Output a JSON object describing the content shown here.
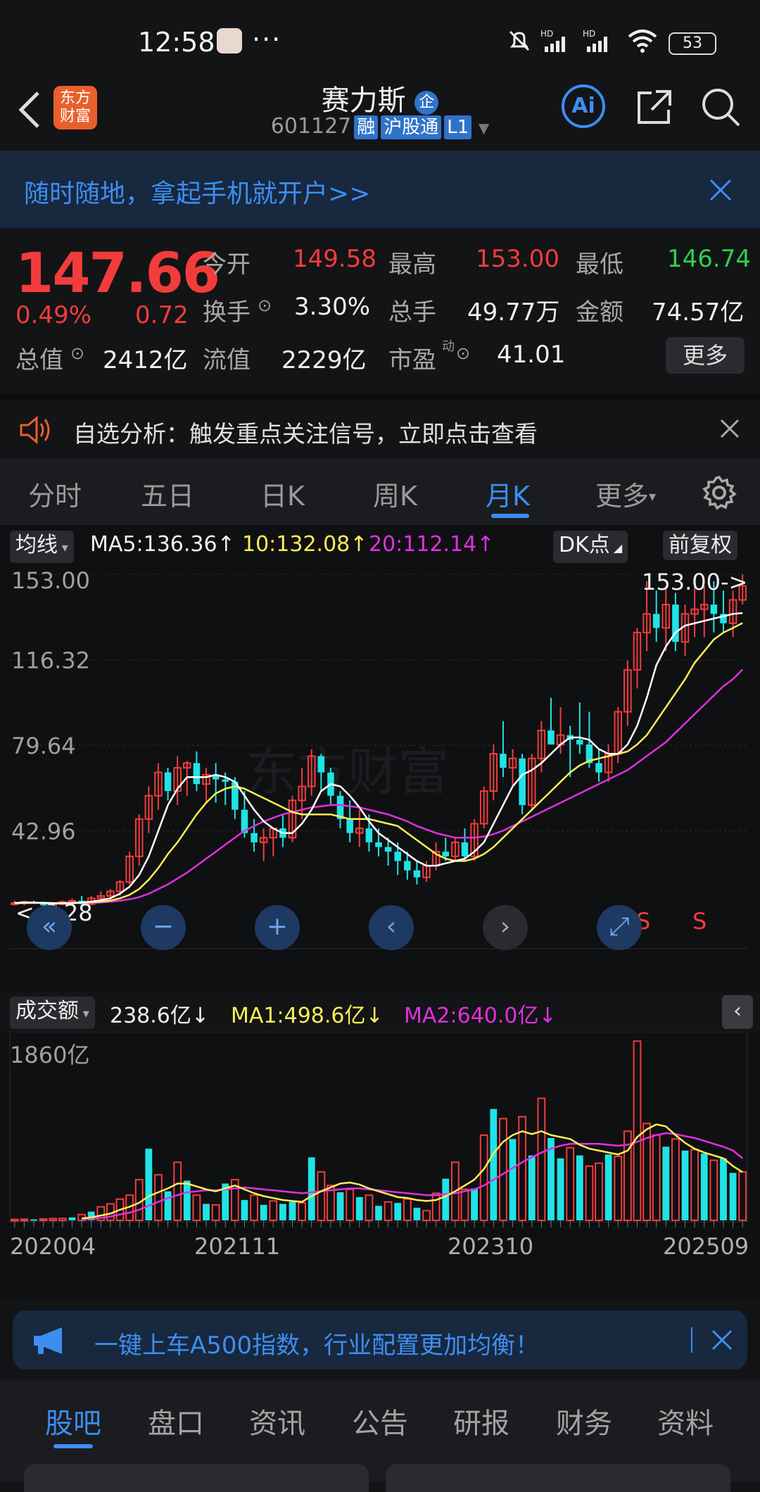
{
  "status_bar": {
    "time": "12:58",
    "more": "···",
    "battery": "53"
  },
  "header": {
    "logo_text": "东方\n财富",
    "stock_name": "赛力斯",
    "stock_badge": "企",
    "stock_code": "601127",
    "tags": [
      "融",
      "沪股通",
      "L1"
    ],
    "ai_label": "Ai"
  },
  "banner": {
    "text": "随时随地，拿起手机就开户>>"
  },
  "quote": {
    "price": "147.66",
    "change_pct": "0.49%",
    "change": "0.72",
    "open_label": "今开",
    "open": "149.58",
    "high_label": "最高",
    "high": "153.00",
    "low_label": "最低",
    "low": "146.74",
    "turnover_label": "换手",
    "turnover": "3.30%",
    "volume_label": "总手",
    "volume": "49.77万",
    "amount_label": "金额",
    "amount": "74.57亿",
    "mktcap_label": "总值",
    "mktcap": "2412亿",
    "float_label": "流值",
    "float": "2229亿",
    "pe_label": "市盈",
    "pe_sup": "动",
    "pe": "41.01",
    "more_button": "更多"
  },
  "alert": {
    "text": "自选分析：触发重点关注信号，立即点击查看"
  },
  "tabs": [
    "分时",
    "五日",
    "日K",
    "周K",
    "月K",
    "更多"
  ],
  "active_tab": "月K",
  "chart_toolbar": {
    "ma_selector": "均线",
    "ma5": "MA5:136.36↑",
    "ma10": "10:132.08↑",
    "ma20": "20:112.14↑",
    "dk_button": "DK点",
    "adjust_button": "前复权"
  },
  "vol_toolbar": {
    "selector": "成交额",
    "current": "238.6亿↓",
    "ma1": "MA1:498.6亿↓",
    "ma2": "MA2:640.0亿↓"
  },
  "colors": {
    "up": "#f23c3c",
    "down": "#1fe3e6",
    "ma5": "#ffffff",
    "ma10": "#ffee55",
    "ma20": "#e030e0",
    "accent": "#3b8ef2"
  },
  "chart_data": [
    {
      "type": "candlestick",
      "y_tick_labels": [
        "153.00",
        "116.32",
        "79.64",
        "42.96"
      ],
      "ylim": [
        6.28,
        153.0
      ],
      "annotations": {
        "max_label": "153.00->",
        "min_label": "<-6.28",
        "signals": [
          "S",
          "S"
        ]
      },
      "x_tick_labels": [
        "202004",
        "202111",
        "202310",
        "202509"
      ],
      "ohlc": [
        [
          12,
          13,
          11,
          12
        ],
        [
          12,
          13,
          11,
          12.5
        ],
        [
          12.5,
          13,
          11.5,
          12
        ],
        [
          12,
          12.5,
          10.5,
          11
        ],
        [
          11,
          12,
          10,
          11.5
        ],
        [
          11.5,
          13,
          11,
          12.5
        ],
        [
          12.5,
          14,
          12,
          13
        ],
        [
          13,
          15,
          11,
          11.5
        ],
        [
          11.5,
          15,
          11,
          14
        ],
        [
          14,
          17,
          12,
          15
        ],
        [
          15,
          18,
          13,
          17
        ],
        [
          17,
          22,
          15,
          21
        ],
        [
          21,
          34,
          20,
          32
        ],
        [
          32,
          50,
          28,
          48
        ],
        [
          48,
          62,
          42,
          58
        ],
        [
          58,
          72,
          52,
          68
        ],
        [
          68,
          70,
          56,
          60
        ],
        [
          60,
          75,
          54,
          70
        ],
        [
          70,
          73,
          58,
          72
        ],
        [
          72,
          77,
          60,
          63
        ],
        [
          63,
          70,
          55,
          67
        ],
        [
          67,
          72,
          55,
          65
        ],
        [
          65,
          68,
          54,
          64
        ],
        [
          64,
          66,
          48,
          52
        ],
        [
          52,
          60,
          40,
          42
        ],
        [
          42,
          48,
          34,
          38
        ],
        [
          38,
          44,
          30,
          40
        ],
        [
          40,
          44,
          32,
          44
        ],
        [
          44,
          50,
          36,
          40
        ],
        [
          40,
          58,
          38,
          56
        ],
        [
          56,
          70,
          48,
          62
        ],
        [
          62,
          78,
          58,
          75
        ],
        [
          75,
          76,
          60,
          68
        ],
        [
          68,
          70,
          54,
          58
        ],
        [
          58,
          60,
          44,
          48
        ],
        [
          48,
          56,
          38,
          42
        ],
        [
          42,
          52,
          36,
          44
        ],
        [
          44,
          50,
          34,
          38
        ],
        [
          38,
          44,
          32,
          36
        ],
        [
          36,
          40,
          28,
          34
        ],
        [
          34,
          38,
          24,
          30
        ],
        [
          30,
          34,
          22,
          26
        ],
        [
          26,
          30,
          20,
          23
        ],
        [
          23,
          30,
          21,
          28
        ],
        [
          28,
          38,
          26,
          34
        ],
        [
          34,
          40,
          30,
          32
        ],
        [
          32,
          40,
          30,
          38
        ],
        [
          38,
          44,
          30,
          32
        ],
        [
          32,
          48,
          30,
          46
        ],
        [
          46,
          62,
          44,
          60
        ],
        [
          60,
          80,
          56,
          76
        ],
        [
          76,
          90,
          66,
          70
        ],
        [
          70,
          78,
          62,
          74
        ],
        [
          74,
          76,
          50,
          54
        ],
        [
          54,
          76,
          52,
          74
        ],
        [
          74,
          90,
          68,
          86
        ],
        [
          86,
          100,
          80,
          80
        ],
        [
          80,
          96,
          76,
          84
        ],
        [
          84,
          88,
          66,
          82
        ],
        [
          82,
          98,
          76,
          80
        ],
        [
          80,
          94,
          70,
          72
        ],
        [
          72,
          78,
          64,
          68
        ],
        [
          68,
          80,
          64,
          76
        ],
        [
          76,
          96,
          72,
          94
        ],
        [
          94,
          116,
          88,
          112
        ],
        [
          112,
          130,
          104,
          128
        ],
        [
          128,
          150,
          120,
          136
        ],
        [
          136,
          146,
          124,
          130
        ],
        [
          130,
          148,
          120,
          140
        ],
        [
          140,
          145,
          120,
          124
        ],
        [
          124,
          140,
          118,
          136
        ],
        [
          136,
          150,
          126,
          138
        ],
        [
          138,
          148,
          126,
          140
        ],
        [
          140,
          150,
          128,
          136
        ],
        [
          136,
          146,
          128,
          132
        ],
        [
          132,
          146,
          126,
          142
        ],
        [
          142,
          153,
          140,
          148
        ]
      ],
      "ma": {
        "MA5": [
          12,
          12.2,
          12.2,
          12,
          11.8,
          11.8,
          12,
          12.2,
          12.6,
          13.2,
          14,
          16,
          19,
          24,
          32,
          43,
          54,
          61,
          66,
          66,
          66,
          67,
          66,
          64,
          58,
          52,
          47,
          44,
          42,
          42,
          46,
          52,
          60,
          63,
          62,
          58,
          53,
          47,
          42,
          39,
          36,
          33,
          30,
          28,
          28,
          29,
          30,
          31,
          34,
          38,
          46,
          54,
          62,
          67,
          69,
          72,
          76,
          80,
          83,
          83,
          82,
          78,
          76,
          76,
          80,
          88,
          100,
          114,
          122,
          128,
          131,
          132,
          133,
          134,
          135,
          136,
          136.36
        ],
        "MA10": [
          12,
          12,
          12.1,
          12.1,
          12,
          12,
          12,
          12.1,
          12.3,
          12.6,
          13,
          14,
          15.5,
          18,
          22,
          27,
          33,
          38,
          44,
          50,
          55,
          59,
          61,
          62,
          61,
          59,
          57,
          55,
          53,
          51,
          50,
          50,
          50,
          50,
          49,
          48,
          48,
          48,
          47,
          46,
          45,
          42,
          39,
          36,
          33,
          31,
          30,
          30,
          31,
          33,
          36,
          40,
          44,
          48,
          52,
          56,
          60,
          64,
          68,
          71,
          73,
          74,
          75,
          76,
          77,
          80,
          84,
          90,
          96,
          102,
          108,
          115,
          120,
          125,
          128,
          130,
          132.08
        ],
        "MA20": [
          12,
          12,
          12,
          12,
          12,
          12,
          12,
          12,
          12,
          12.2,
          12.5,
          13,
          13.6,
          14.5,
          16,
          18,
          20,
          22.5,
          25,
          28,
          31,
          34,
          37,
          40,
          43,
          45,
          47,
          48.5,
          50,
          51,
          52,
          53,
          53.5,
          54,
          54,
          53.5,
          53,
          52,
          51,
          50,
          48.5,
          47,
          45,
          43.5,
          42,
          41,
          40,
          40,
          40,
          40.5,
          41.5,
          43,
          45,
          47,
          49,
          51,
          53,
          55,
          57,
          59,
          61,
          63,
          65,
          67,
          69,
          72,
          75,
          78,
          81,
          85,
          89,
          93,
          97,
          101,
          105,
          108,
          112.14
        ]
      }
    },
    {
      "type": "bar",
      "title": "成交额",
      "y_tick_labels": [
        "1860亿"
      ],
      "ylim": [
        0,
        1860
      ],
      "values": [
        10,
        12,
        10,
        14,
        18,
        20,
        30,
        60,
        90,
        140,
        170,
        220,
        260,
        420,
        740,
        470,
        300,
        600,
        410,
        260,
        170,
        160,
        380,
        420,
        210,
        260,
        160,
        200,
        170,
        190,
        180,
        650,
        500,
        360,
        290,
        320,
        240,
        260,
        150,
        190,
        180,
        220,
        130,
        100,
        280,
        430,
        600,
        320,
        330,
        880,
        1150,
        1050,
        840,
        1070,
        670,
        1260,
        850,
        640,
        750,
        670,
        560,
        590,
        680,
        660,
        920,
        1850,
        1000,
        880,
        760,
        840,
        720,
        730,
        690,
        620,
        640,
        490,
        500
      ],
      "up_flags": [
        1,
        1,
        0,
        1,
        1,
        1,
        0,
        1,
        0,
        1,
        1,
        1,
        1,
        1,
        0,
        1,
        0,
        1,
        0,
        1,
        0,
        1,
        0,
        1,
        0,
        1,
        0,
        1,
        0,
        0,
        1,
        0,
        1,
        1,
        0,
        1,
        0,
        1,
        0,
        1,
        0,
        1,
        0,
        1,
        1,
        0,
        1,
        1,
        0,
        1,
        0,
        1,
        0,
        1,
        0,
        1,
        0,
        0,
        1,
        0,
        1,
        1,
        0,
        1,
        1,
        1,
        1,
        1,
        0,
        1,
        0,
        1,
        0,
        1,
        0,
        0,
        1
      ],
      "ma": {
        "MA1": [
          0,
          0,
          0,
          0,
          0,
          0,
          0,
          20,
          30,
          50,
          70,
          110,
          140,
          180,
          250,
          290,
          330,
          380,
          380,
          350,
          320,
          300,
          330,
          360,
          320,
          280,
          250,
          230,
          210,
          200,
          190,
          250,
          300,
          340,
          380,
          390,
          370,
          330,
          300,
          270,
          240,
          230,
          210,
          200,
          210,
          250,
          300,
          360,
          420,
          530,
          690,
          810,
          880,
          920,
          890,
          920,
          880,
          860,
          840,
          780,
          740,
          720,
          700,
          680,
          720,
          860,
          940,
          990,
          970,
          880,
          800,
          740,
          700,
          670,
          640,
          560,
          498.6
        ],
        "MA2": [
          0,
          0,
          0,
          0,
          0,
          0,
          0,
          10,
          15,
          25,
          40,
          60,
          80,
          110,
          150,
          190,
          230,
          260,
          290,
          300,
          310,
          310,
          320,
          330,
          340,
          330,
          320,
          310,
          300,
          290,
          280,
          290,
          300,
          310,
          320,
          330,
          330,
          320,
          310,
          300,
          290,
          280,
          270,
          260,
          260,
          270,
          280,
          300,
          320,
          360,
          420,
          480,
          540,
          600,
          650,
          700,
          740,
          770,
          790,
          790,
          790,
          790,
          780,
          770,
          780,
          810,
          850,
          880,
          900,
          890,
          870,
          850,
          820,
          790,
          760,
          720,
          640.0
        ]
      }
    }
  ],
  "nav_controls": [
    "«",
    "−",
    "+",
    "‹",
    "›"
  ],
  "ad": {
    "text": "一键上车A500指数，行业配置更加均衡！"
  },
  "bottom_tabs": [
    "股吧",
    "盘口",
    "资讯",
    "公告",
    "研报",
    "财务",
    "资料"
  ],
  "active_bottom_tab": "股吧"
}
